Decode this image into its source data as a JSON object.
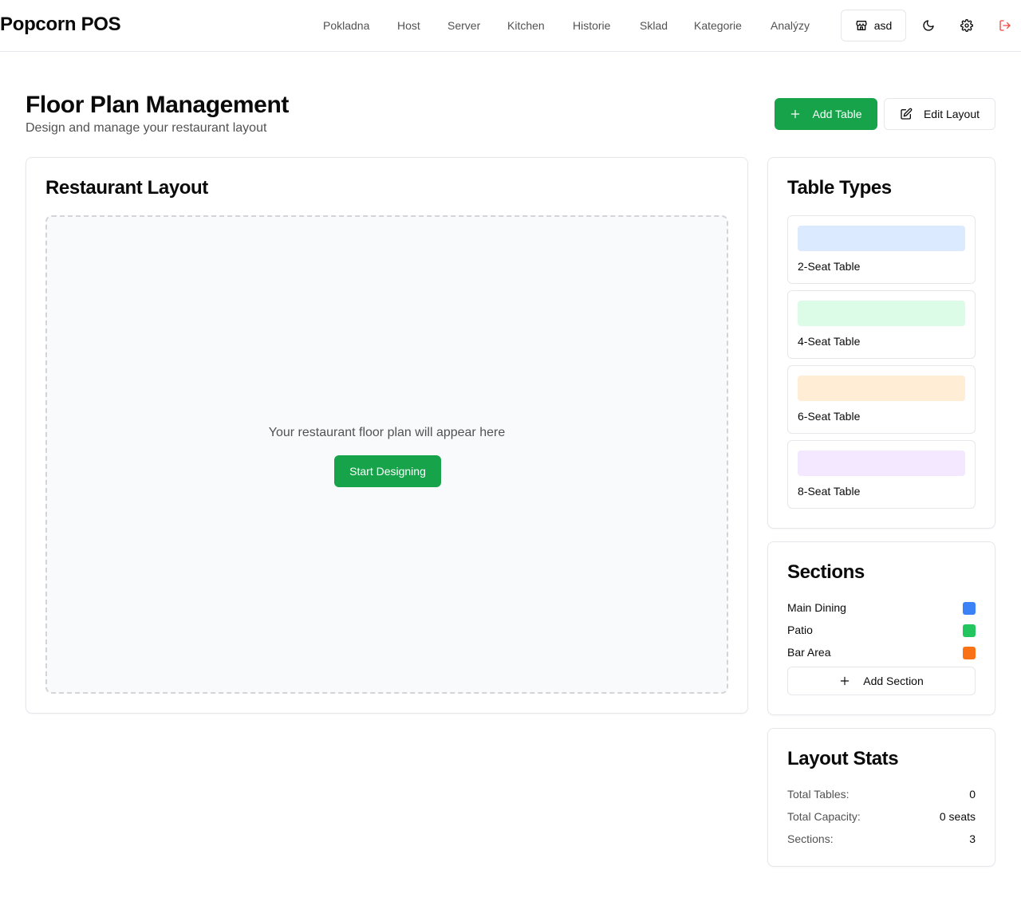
{
  "header": {
    "brand": "Popcorn POS",
    "nav": [
      "Pokladna",
      "Host",
      "Server",
      "Kitchen",
      "Historie",
      "Sklad",
      "Kategorie",
      "Analýzy"
    ],
    "store_label": "asd",
    "icons": {
      "store": "store-icon",
      "theme": "moon-icon",
      "settings": "gear-icon",
      "logout": "logout-icon"
    }
  },
  "page": {
    "title": "Floor Plan Management",
    "subtitle": "Design and manage your restaurant layout",
    "add_table_label": "Add Table",
    "edit_layout_label": "Edit Layout"
  },
  "layout": {
    "title": "Restaurant Layout",
    "empty_text": "Your restaurant floor plan will appear here",
    "start_label": "Start Designing"
  },
  "table_types": {
    "title": "Table Types",
    "items": [
      {
        "label": "2-Seat Table",
        "color": "#dbeafe"
      },
      {
        "label": "4-Seat Table",
        "color": "#dcfce7"
      },
      {
        "label": "6-Seat Table",
        "color": "#ffedd5"
      },
      {
        "label": "8-Seat Table",
        "color": "#f3e8ff"
      }
    ]
  },
  "sections": {
    "title": "Sections",
    "items": [
      {
        "label": "Main Dining",
        "color": "#3b82f6"
      },
      {
        "label": "Patio",
        "color": "#22c55e"
      },
      {
        "label": "Bar Area",
        "color": "#f97316"
      }
    ],
    "add_label": "Add Section"
  },
  "stats": {
    "title": "Layout Stats",
    "rows": [
      {
        "label": "Total Tables:",
        "value": "0"
      },
      {
        "label": "Total Capacity:",
        "value": "0 seats"
      },
      {
        "label": "Sections:",
        "value": "3"
      }
    ]
  },
  "colors": {
    "accent": "#16a34a",
    "logout": "#ef4444"
  }
}
